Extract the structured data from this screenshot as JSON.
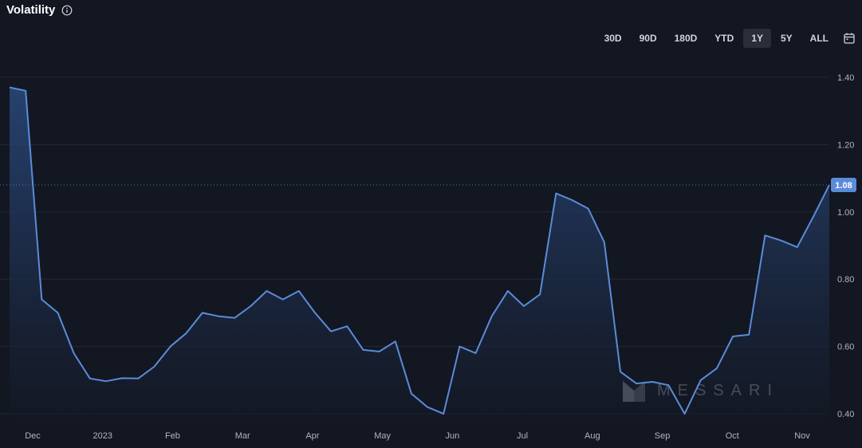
{
  "header": {
    "title": "Volatility",
    "info_icon": "info-circle-icon",
    "calendar_icon": "calendar-icon"
  },
  "range_buttons": [
    {
      "label": "30D",
      "active": false
    },
    {
      "label": "90D",
      "active": false
    },
    {
      "label": "180D",
      "active": false
    },
    {
      "label": "YTD",
      "active": false
    },
    {
      "label": "1Y",
      "active": true
    },
    {
      "label": "5Y",
      "active": false
    },
    {
      "label": "ALL",
      "active": false
    }
  ],
  "watermark": {
    "text": "MESSARI"
  },
  "colors": {
    "background": "#131722",
    "line": "#5b8bd9",
    "area_top": "#2a4a7e",
    "area_bottom": "#131722",
    "grid": "#242836",
    "axis_text": "#b2b5be",
    "badge": "#5b8bd9"
  },
  "chart_data": {
    "type": "area",
    "title": "Volatility",
    "xlabel": "",
    "ylabel": "",
    "ylim": [
      0.36,
      1.44
    ],
    "grid": true,
    "x_tick_labels": [
      "Dec",
      "2023",
      "Feb",
      "Mar",
      "Apr",
      "May",
      "Jun",
      "Jul",
      "Aug",
      "Sep",
      "Oct",
      "Nov"
    ],
    "y_tick_labels": [
      "1.40",
      "1.20",
      "1.00",
      "0.80",
      "0.60",
      "0.40"
    ],
    "y_ticks": [
      1.4,
      1.2,
      1.0,
      0.8,
      0.6,
      0.4
    ],
    "last_value_label": "1.08",
    "last_value": 1.08,
    "series": [
      {
        "values": [
          1.37,
          1.36,
          0.74,
          0.7,
          0.58,
          0.505,
          0.497,
          0.506,
          0.505,
          0.54,
          0.6,
          0.64,
          0.7,
          0.69,
          0.685,
          0.72,
          0.765,
          0.74,
          0.765,
          0.7,
          0.645,
          0.66,
          0.59,
          0.585,
          0.615,
          0.46,
          0.42,
          0.4,
          0.6,
          0.58,
          0.69,
          0.765,
          0.72,
          0.755,
          1.055,
          1.035,
          1.01,
          0.91,
          0.525,
          0.49,
          0.495,
          0.485,
          0.4,
          0.5,
          0.535,
          0.63,
          0.635,
          0.93,
          0.915,
          0.895,
          0.985,
          1.08
        ]
      }
    ]
  }
}
